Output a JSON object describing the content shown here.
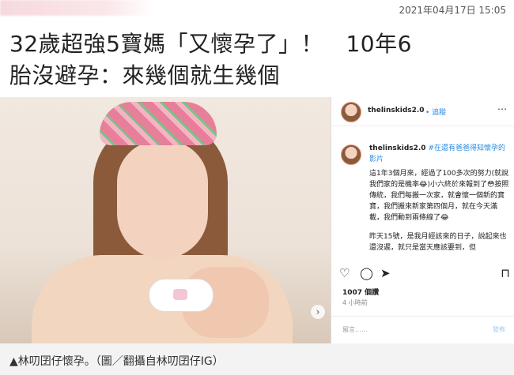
{
  "timestamp": "2021年04月17日 15:05",
  "headline": {
    "line1": "32歲超強5寶媽「又懷孕了」！　10年6",
    "line2": "胎沒避孕：來幾個就生幾個"
  },
  "instagram": {
    "username": "thelinskids2.0",
    "follow": "• 追蹤",
    "more_icon": "⋯",
    "caption_user": "thelinskids2.0",
    "caption_tags": "#在還有爸爸得知懷孕的影片",
    "caption_body": "這1年3個月來，經過了100多次的努力(就說我們家的是機率😂)小六終於來報到了😳按照傳統，我們每搬一次家，就會懷一個新的寶寶，我們搬來新家第四個月，就在今天滿載，我們動到兩條線了😂",
    "caption_body2": "昨天15號，是我月經該來的日子，說起來也還沒遲，就只是當天應該要到，但",
    "likes": "1007 個讚",
    "ago": "4 小時前",
    "comment_placeholder": "留言……",
    "post_button": "發佈"
  },
  "photo_caption": "▲林叨囝仔懷孕。（圖／翻攝自林叨囝仔IG）"
}
